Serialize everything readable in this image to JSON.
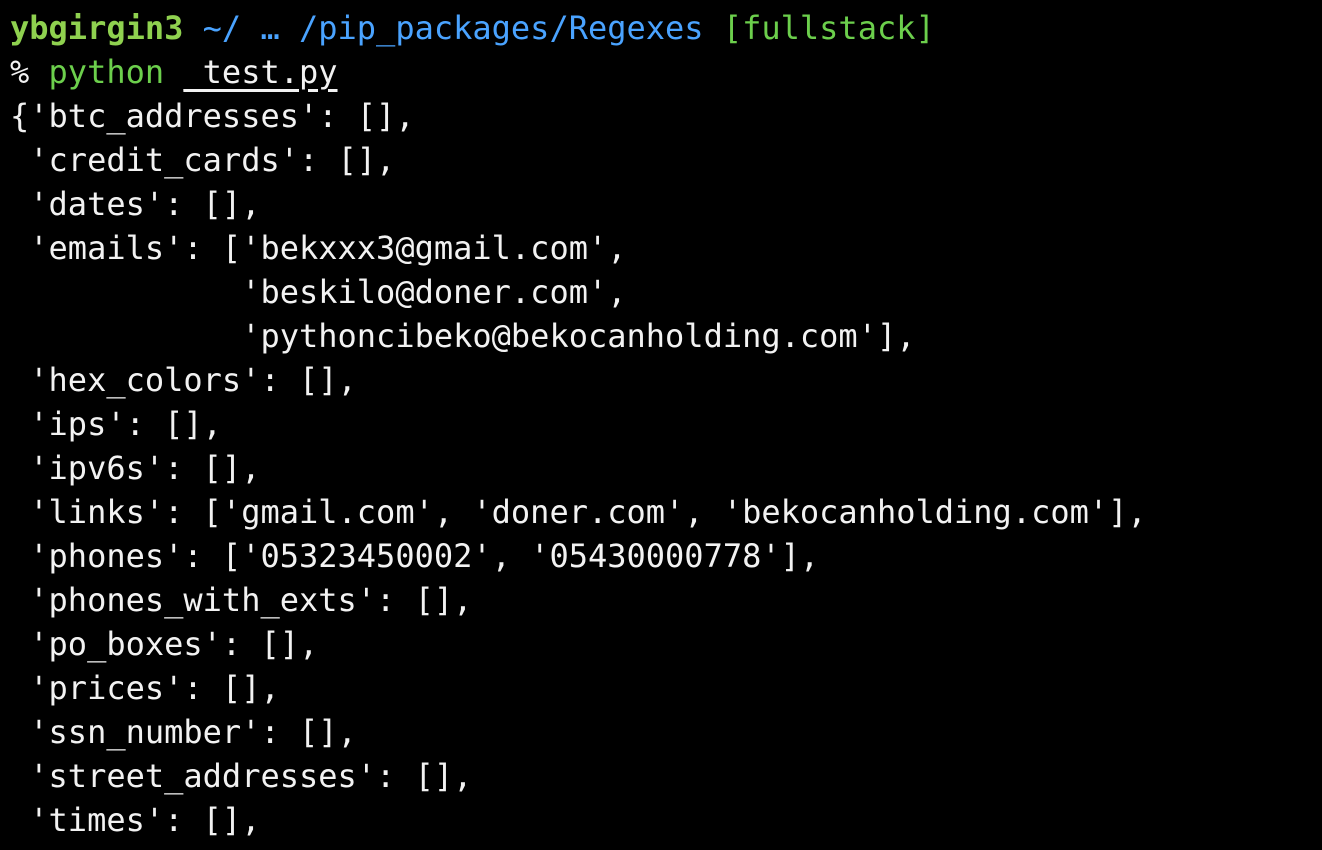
{
  "prompt": {
    "user": "ybgirgin3",
    "path": "~/ … /pip_packages/Regexes",
    "branch": "[fullstack]",
    "symbol": "%",
    "command": "python",
    "argument": "_test.py"
  },
  "output_lines": [
    "{'btc_addresses': [],",
    " 'credit_cards': [],",
    " 'dates': [],",
    " 'emails': ['bekxxx3@gmail.com',",
    "            'beskilo@doner.com',",
    "            'pythoncibeko@bekocanholding.com'],",
    " 'hex_colors': [],",
    " 'ips': [],",
    " 'ipv6s': [],",
    " 'links': ['gmail.com', 'doner.com', 'bekocanholding.com'],",
    " 'phones': ['05323450002', '05430000778'],",
    " 'phones_with_exts': [],",
    " 'po_boxes': [],",
    " 'prices': [],",
    " 'ssn_number': [],",
    " 'street_addresses': [],",
    " 'times': [],"
  ],
  "colors": {
    "background": "#000000",
    "text": "#f2f2f2",
    "user": "#8fd14f",
    "path": "#4aa3ff",
    "branch": "#6ccf4c"
  }
}
